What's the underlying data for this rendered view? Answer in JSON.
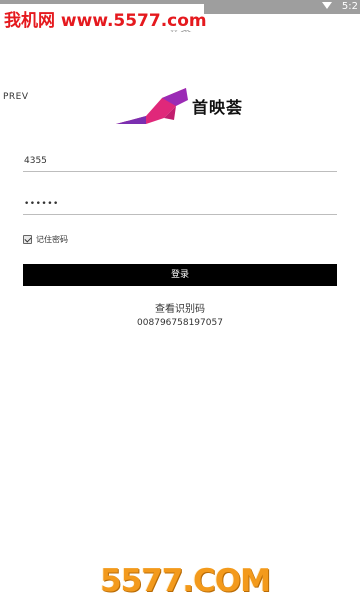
{
  "status_bar": {
    "time": "5:2"
  },
  "watermark_top": {
    "text": "我机网 www.5577.com"
  },
  "header": {
    "title": "登录",
    "prev_label": "PREV"
  },
  "logo": {
    "text": "首映荟",
    "colors": {
      "primary": "#e0287a",
      "secondary": "#7b2fb0"
    }
  },
  "form": {
    "username_value": "4355",
    "password_value": "••••••",
    "remember_label": "记住密码",
    "remember_checked": true,
    "login_label": "登录"
  },
  "footer": {
    "view_code_label": "查看识别码",
    "device_code": "008796758197057"
  },
  "watermark_bottom": {
    "text": "5577.COM"
  },
  "colors": {
    "button_bg": "#000000",
    "watermark_red": "#e5191e",
    "watermark_orange": "#f39a1c"
  }
}
